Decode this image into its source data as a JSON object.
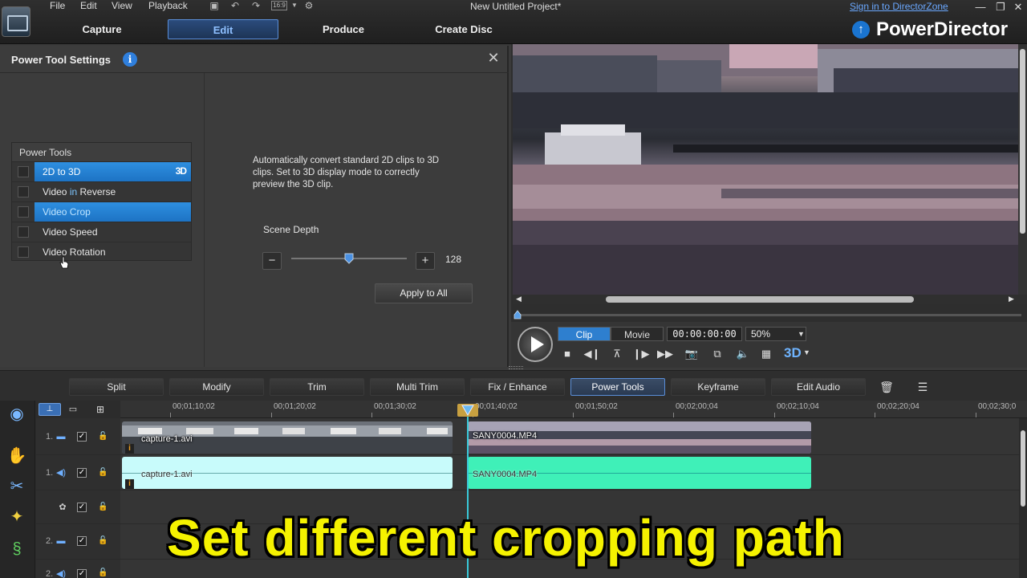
{
  "window": {
    "title": "New Untitled Project*",
    "sign_in": "Sign in to DirectorZone",
    "menu": [
      "File",
      "Edit",
      "View",
      "Playback"
    ],
    "aspect": "16:9"
  },
  "brand": {
    "name": "PowerDirector",
    "icon": "↑"
  },
  "modes": [
    "Capture",
    "Edit",
    "Produce",
    "Create Disc"
  ],
  "panel": {
    "title": "Power Tool Settings",
    "tools_header": "Power Tools",
    "tools": [
      {
        "pre": "2D to 3D",
        "hl": "",
        "post": "",
        "badge": "3D"
      },
      {
        "pre": "Video ",
        "hl": "in",
        "post": " Reverse"
      },
      {
        "pre": "Video Crop",
        "hl": "",
        "post": ""
      },
      {
        "pre": "Video Speed",
        "hl": "",
        "post": ""
      },
      {
        "pre": "Video Rotation",
        "hl": "",
        "post": ""
      }
    ],
    "description": "Automatically convert standard 2D clips to 3D clips. Set to 3D display mode to correctly preview the 3D clip.",
    "scene_depth_label": "Scene Depth",
    "scene_depth_value": "128",
    "scene_depth_fraction": 0.5,
    "minus": "−",
    "plus": "+",
    "apply_all": "Apply to All"
  },
  "preview": {
    "seg_clip": "Clip",
    "seg_movie": "Movie",
    "timecode": "00:00:00:00",
    "zoom": "50%",
    "mode_3d": "3D"
  },
  "toolbar": [
    "Split",
    "Modify",
    "Trim",
    "Multi Trim",
    "Fix / Enhance",
    "Power Tools",
    "Keyframe",
    "Edit Audio"
  ],
  "ruler": [
    "00;01;10;02",
    "00;01;20;02",
    "00;01;30;02",
    "00;01;40;02",
    "00;01;50;02",
    "00;02;00;04",
    "00;02;10;04",
    "00;02;20;04",
    "00;02;30;0"
  ],
  "tracks": [
    {
      "num": "1.",
      "type": "video"
    },
    {
      "num": "1.",
      "type": "audio"
    },
    {
      "num": "",
      "type": "fx"
    },
    {
      "num": "2.",
      "type": "video"
    },
    {
      "num": "2.",
      "type": "audio"
    }
  ],
  "clips": {
    "video1": "capture-1.avi",
    "video2": "SANY0004.MP4",
    "audio1": "capture-1.avi",
    "audio2": "SANY0004.MP4"
  },
  "caption": "Set different cropping path"
}
